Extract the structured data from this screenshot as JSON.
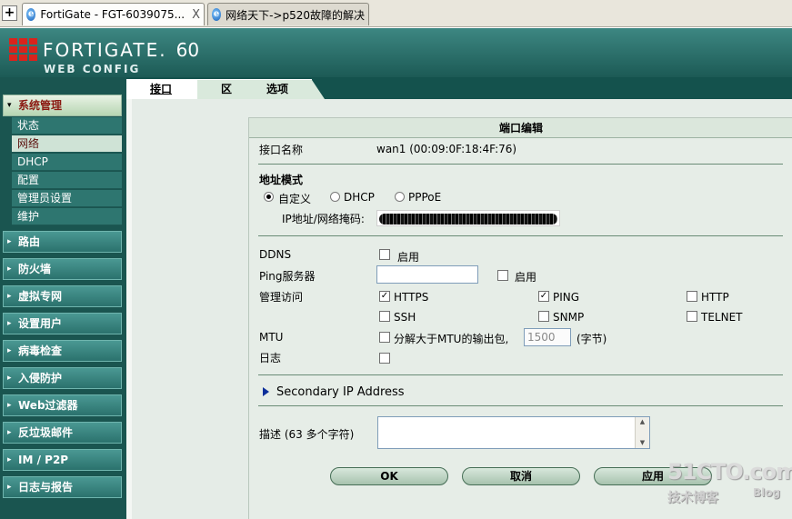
{
  "browser": {
    "new_tab": "+",
    "tabs": [
      {
        "label": "FortiGate - FGT-6039075...",
        "close": "X"
      },
      {
        "label": "网络天下->p520故障的解决"
      }
    ]
  },
  "header": {
    "brand": "FORTIGATE.",
    "model": "60",
    "subtitle": "WEB CONFIG"
  },
  "sidebar": {
    "sections": [
      {
        "label": "系统管理",
        "expanded": true
      },
      {
        "label": "路由"
      },
      {
        "label": "防火墙"
      },
      {
        "label": "虚拟专网"
      },
      {
        "label": "设置用户"
      },
      {
        "label": "病毒检查"
      },
      {
        "label": "入侵防护"
      },
      {
        "label": "Web过滤器"
      },
      {
        "label": "反垃圾邮件"
      },
      {
        "label": "IM / P2P"
      },
      {
        "label": "日志与报告"
      }
    ],
    "sub_items": [
      {
        "label": "状态"
      },
      {
        "label": "网络",
        "selected": true
      },
      {
        "label": "DHCP"
      },
      {
        "label": "配置"
      },
      {
        "label": "管理员设置"
      },
      {
        "label": "维护"
      }
    ]
  },
  "content_tabs": [
    {
      "label": "接口",
      "selected": true
    },
    {
      "label": "区"
    },
    {
      "label": "选项"
    }
  ],
  "form": {
    "title": "端口编辑",
    "interface_name_label": "接口名称",
    "interface_name_value": "wan1 (00:09:0F:18:4F:76)",
    "address_mode_label": "地址模式",
    "modes": [
      {
        "label": "自定义",
        "selected": true
      },
      {
        "label": "DHCP",
        "selected": false
      },
      {
        "label": "PPPoE",
        "selected": false
      }
    ],
    "ip_label": "IP地址/网络掩码:",
    "ddns_label": "DDNS",
    "ddns_enable": "启用",
    "ping_server_label": "Ping服务器",
    "ping_enable": "启用",
    "admin_access_label": "管理访问",
    "access": [
      {
        "label": "HTTPS",
        "checked": true
      },
      {
        "label": "PING",
        "checked": true
      },
      {
        "label": "HTTP",
        "checked": false
      },
      {
        "label": "SSH",
        "checked": false
      },
      {
        "label": "SNMP",
        "checked": false
      },
      {
        "label": "TELNET",
        "checked": false
      }
    ],
    "mtu_label": "MTU",
    "mtu_option": "分解大于MTU的输出包,",
    "mtu_value": "1500",
    "mtu_unit": "(字节)",
    "log_label": "日志",
    "secondary_ip": "Secondary IP Address",
    "description_label": "描述 (63 多个字符)",
    "buttons": {
      "ok": "OK",
      "cancel": "取消",
      "apply": "应用"
    }
  },
  "watermark": {
    "site": "51CTO.com",
    "tagline": "技术博客",
    "blog": "Blog"
  },
  "colors": {
    "sidebar_bg": "#1a5550",
    "header_bg": "#2b726d",
    "accent_red": "#d8241d",
    "panel_bg": "#e6ede7"
  }
}
